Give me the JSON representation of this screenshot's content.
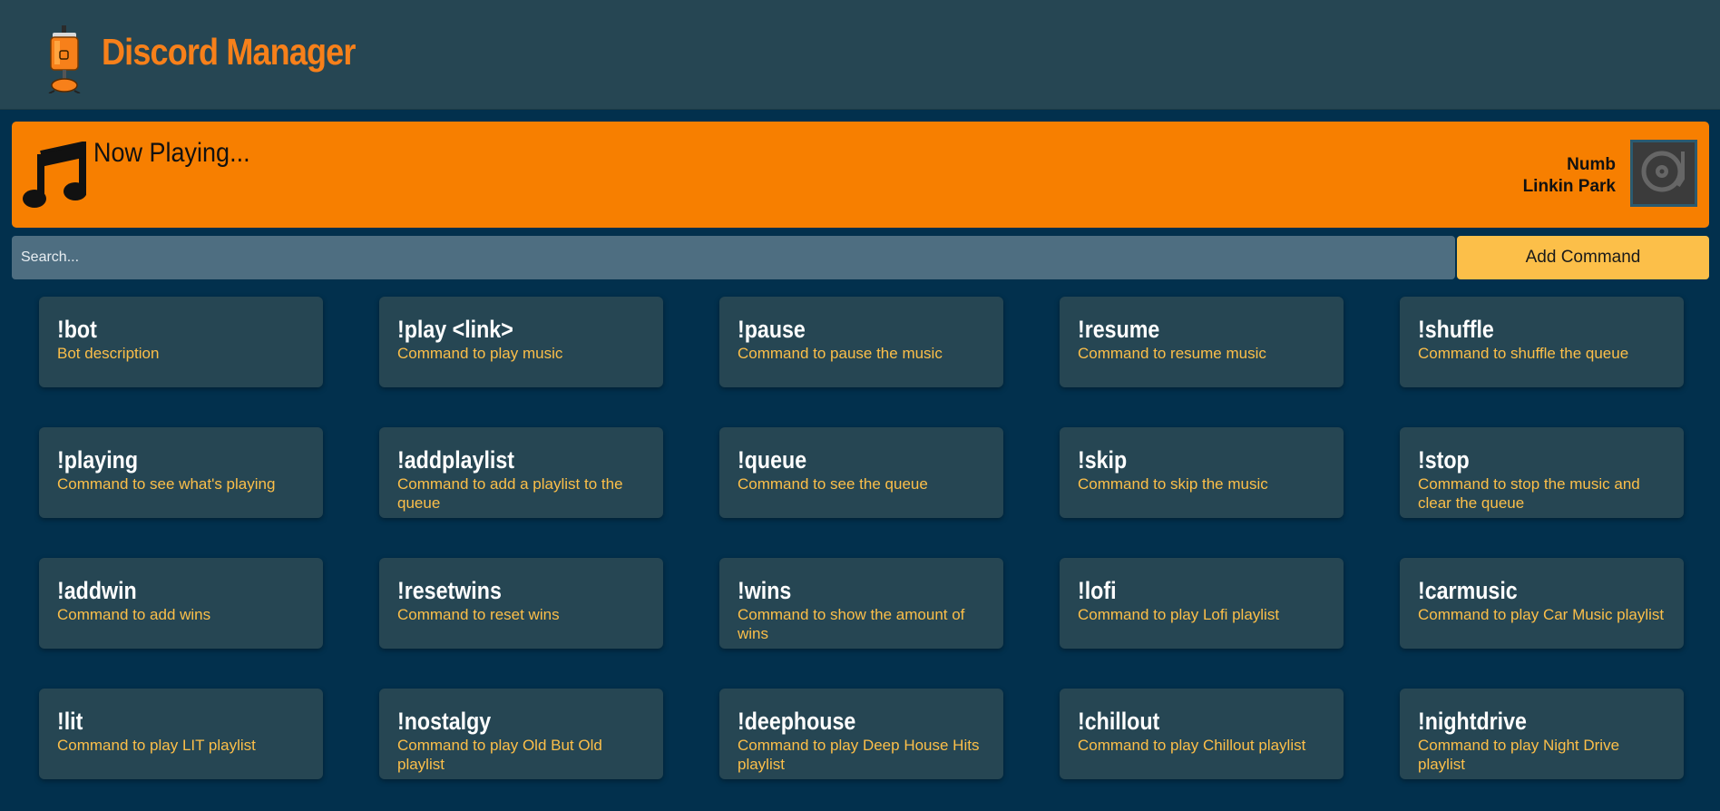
{
  "app": {
    "title": "Discord Manager",
    "logo_icon": "lantern-robot-icon"
  },
  "now_playing": {
    "label": "Now Playing...",
    "track": "Numb",
    "artist": "Linkin Park",
    "icon": "music-note-icon",
    "album_icon": "turntable-icon"
  },
  "search": {
    "placeholder": "Search...",
    "value": ""
  },
  "toolbar": {
    "add_label": "Add Command"
  },
  "commands": [
    {
      "name": "!bot",
      "desc": "Bot description"
    },
    {
      "name": "!play <link>",
      "desc": "Command to play music"
    },
    {
      "name": "!pause",
      "desc": "Command to pause the music"
    },
    {
      "name": "!resume",
      "desc": "Command to resume music"
    },
    {
      "name": "!shuffle",
      "desc": "Command to shuffle the queue"
    },
    {
      "name": "!playing",
      "desc": "Command to see what's playing"
    },
    {
      "name": "!addplaylist",
      "desc": "Command to add a playlist to the queue"
    },
    {
      "name": "!queue",
      "desc": "Command to see the queue"
    },
    {
      "name": "!skip",
      "desc": "Command to skip the music"
    },
    {
      "name": "!stop",
      "desc": "Command to stop the music and clear the queue"
    },
    {
      "name": "!addwin",
      "desc": "Command to add wins"
    },
    {
      "name": "!resetwins",
      "desc": "Command to reset wins"
    },
    {
      "name": "!wins",
      "desc": "Command to show the amount of wins"
    },
    {
      "name": "!lofi",
      "desc": "Command to play Lofi playlist"
    },
    {
      "name": "!carmusic",
      "desc": "Command to play Car Music playlist"
    },
    {
      "name": "!lit",
      "desc": "Command to play LIT playlist"
    },
    {
      "name": "!nostalgy",
      "desc": "Command to play Old But Old playlist"
    },
    {
      "name": "!deephouse",
      "desc": "Command to play Deep House Hits playlist"
    },
    {
      "name": "!chillout",
      "desc": "Command to play Chillout playlist"
    },
    {
      "name": "!nightdrive",
      "desc": "Command to play Night Drive playlist"
    }
  ],
  "colors": {
    "background": "#02304d",
    "header": "#264653",
    "accent_orange": "#f77f00",
    "accent_yellow": "#fcbf49",
    "search_bg": "#4e6e81"
  }
}
